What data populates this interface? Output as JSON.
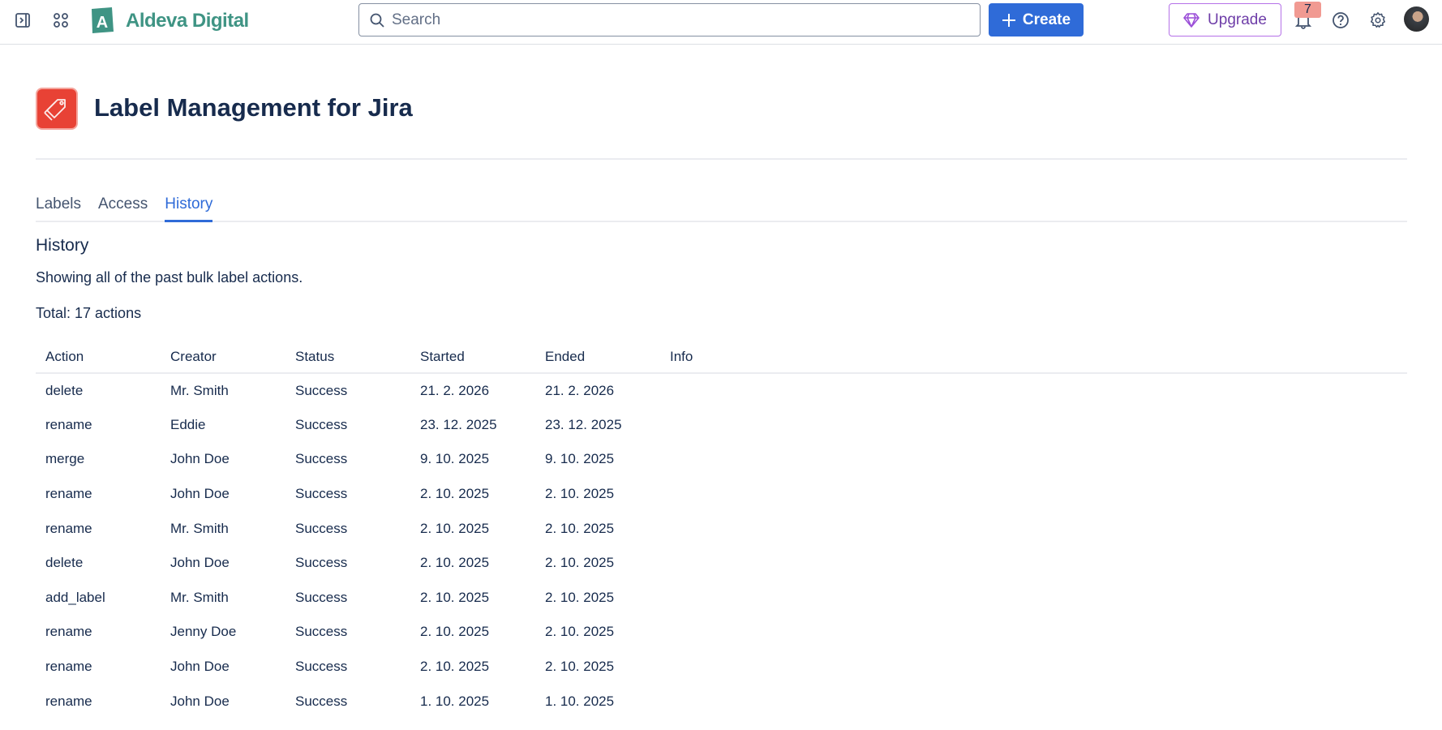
{
  "topbar": {
    "brand": "Aldeva Digital",
    "brand_letter": "A",
    "search_placeholder": "Search",
    "create_label": "Create",
    "upgrade_label": "Upgrade",
    "notification_count": "7"
  },
  "app": {
    "title": "Label Management for Jira"
  },
  "tabs": [
    {
      "label": "Labels"
    },
    {
      "label": "Access"
    },
    {
      "label": "History"
    }
  ],
  "history": {
    "heading": "History",
    "description": "Showing all of the past bulk label actions.",
    "total": "Total: 17 actions"
  },
  "table": {
    "columns": [
      "Action",
      "Creator",
      "Status",
      "Started",
      "Ended",
      "Info"
    ],
    "rows": [
      [
        "delete",
        "Mr. Smith",
        "Success",
        "21. 2. 2026",
        "21. 2. 2026",
        ""
      ],
      [
        "rename",
        "Eddie",
        "Success",
        "23. 12. 2025",
        "23. 12. 2025",
        ""
      ],
      [
        "merge",
        "John Doe",
        "Success",
        "9. 10. 2025",
        "9. 10. 2025",
        ""
      ],
      [
        "rename",
        "John Doe",
        "Success",
        "2. 10. 2025",
        "2. 10. 2025",
        ""
      ],
      [
        "rename",
        "Mr. Smith",
        "Success",
        "2. 10. 2025",
        "2. 10. 2025",
        ""
      ],
      [
        "delete",
        "John Doe",
        "Success",
        "2. 10. 2025",
        "2. 10. 2025",
        ""
      ],
      [
        "add_label",
        "Mr. Smith",
        "Success",
        "2. 10. 2025",
        "2. 10. 2025",
        ""
      ],
      [
        "rename",
        "Jenny Doe",
        "Success",
        "2. 10. 2025",
        "2. 10. 2025",
        ""
      ],
      [
        "rename",
        "John Doe",
        "Success",
        "2. 10. 2025",
        "2. 10. 2025",
        ""
      ],
      [
        "rename",
        "John Doe",
        "Success",
        "1. 10. 2025",
        "1. 10. 2025",
        ""
      ]
    ]
  }
}
